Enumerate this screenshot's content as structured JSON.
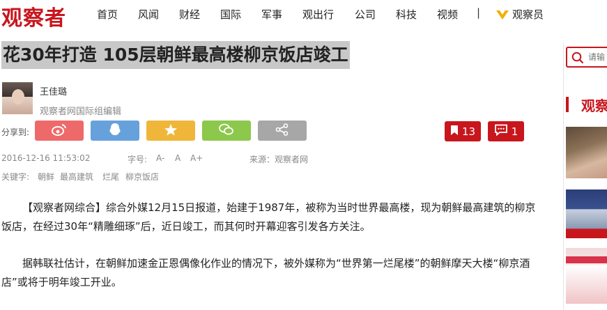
{
  "site": {
    "logo": "观察者"
  },
  "nav": {
    "items": [
      "首页",
      "风闻",
      "财经",
      "国际",
      "军事",
      "观出行",
      "公司",
      "科技",
      "视频"
    ],
    "separator": "|",
    "member": "观察员"
  },
  "article": {
    "title": "花30年打造 105层朝鲜最高楼柳京饭店竣工",
    "author": {
      "name": "王佳璐",
      "role": "观察者网国际组编辑"
    },
    "share": {
      "label": "分享到:"
    },
    "stats": {
      "bookmarks": "13",
      "comments": "1"
    },
    "meta": {
      "datetime": "2016-12-16 11:53:02",
      "fontsize_label": "字号:",
      "fontsize_options": [
        "A-",
        "A",
        "A+"
      ],
      "source": "来源：观察者网"
    },
    "keywords": {
      "label": "关键字:",
      "items": [
        "朝鲜",
        "最高建筑",
        "烂尾",
        "柳京饭店"
      ]
    },
    "paragraphs": [
      "【观察者网综合】综合外媒12月15日报道，始建于1987年，被称为当时世界最高楼，现为朝鲜最高建筑的柳京饭店，在经过30年“精雕细琢”后，近日竣工，而其何时开幕迎客引发各方关注。",
      "据韩联社估计，在朝鲜加速金正恩偶像化作业的情况下，被外媒称为“世界第一烂尾楼”的朝鲜摩天大楼“柳京酒店”或将于明年竣工开业。"
    ]
  },
  "sidebar": {
    "search_placeholder": "请输",
    "section_title": "观察"
  },
  "colors": {
    "brand_red": "#c8161d",
    "weibo": "#ee6a6a",
    "qq": "#67a1dc",
    "qzone": "#f0b63a",
    "wechat": "#8cc84b",
    "more": "#a7a7a7"
  },
  "icons": [
    "v-member-icon",
    "weibo-icon",
    "qq-icon",
    "qzone-icon",
    "wechat-icon",
    "share-more-icon",
    "bookmark-icon",
    "comment-icon",
    "search-icon"
  ]
}
